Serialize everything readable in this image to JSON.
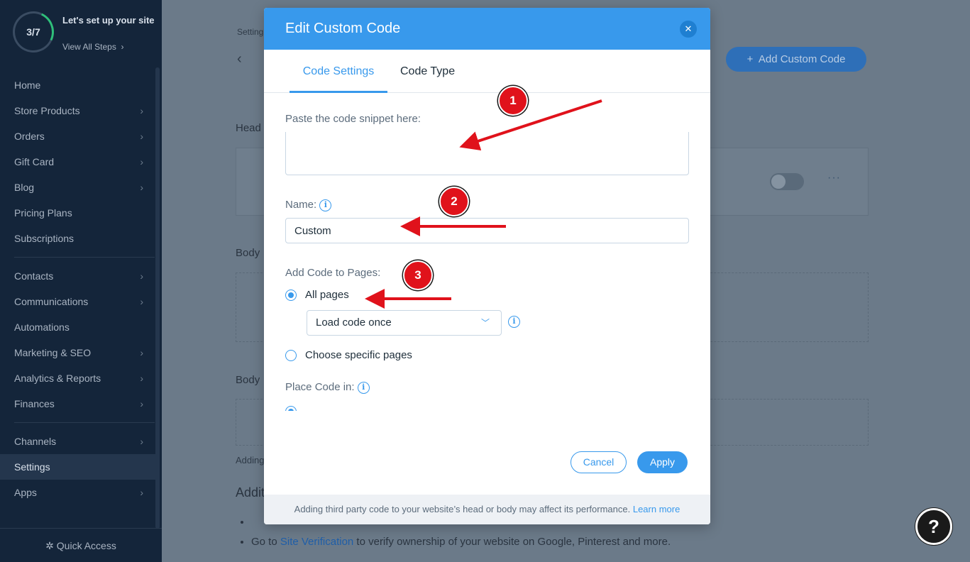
{
  "sidebar": {
    "progress": "3/7",
    "setup_title": "Let's set up your site",
    "setup_link": "View All Steps",
    "items": [
      {
        "label": "Home",
        "chevron": false
      },
      {
        "label": "Store Products",
        "chevron": true
      },
      {
        "label": "Orders",
        "chevron": true
      },
      {
        "label": "Gift Card",
        "chevron": true
      },
      {
        "label": "Blog",
        "chevron": true
      },
      {
        "label": "Pricing Plans",
        "chevron": false
      },
      {
        "label": "Subscriptions",
        "chevron": false
      },
      {
        "label": "Contacts",
        "chevron": true
      },
      {
        "label": "Communications",
        "chevron": true
      },
      {
        "label": "Automations",
        "chevron": false
      },
      {
        "label": "Marketing & SEO",
        "chevron": true
      },
      {
        "label": "Analytics & Reports",
        "chevron": true
      },
      {
        "label": "Finances",
        "chevron": true
      },
      {
        "label": "Channels",
        "chevron": true
      },
      {
        "label": "Settings",
        "chevron": false,
        "active": true
      },
      {
        "label": "Apps",
        "chevron": true
      }
    ],
    "quick_access": "Quick Access"
  },
  "page": {
    "breadcrumb": "Setting",
    "add_button": "Add Custom Code",
    "head_label": "Head",
    "body_label_1": "Body",
    "body_label_2": "Body",
    "adding_note": "Adding",
    "additional_title": "Additi",
    "bullet_2_prefix": "Go to",
    "bullet_2_link": "Site Verification",
    "bullet_2_suffix": "to verify ownership of your website on Google, Pinterest and more."
  },
  "modal": {
    "title": "Edit Custom Code",
    "tabs": [
      "Code Settings",
      "Code Type"
    ],
    "active_tab": "Code Settings",
    "snippet_label": "Paste the code snippet here:",
    "snippet_value": "",
    "name_label": "Name:",
    "name_value": "Custom",
    "pages_label": "Add Code to Pages:",
    "option_all": "All pages",
    "option_all_selected": true,
    "load_select": "Load code once",
    "option_specific": "Choose specific pages",
    "place_label": "Place Code in:",
    "cancel": "Cancel",
    "apply": "Apply",
    "footer_note": "Adding third party code to your website’s head or body may affect its performance.",
    "footer_link": "Learn more"
  },
  "annotations": {
    "badges": [
      "1",
      "2",
      "3"
    ],
    "arrow_color": "#e0121b"
  },
  "help_label": "?",
  "colors": {
    "accent": "#3899ec",
    "sidebar_bg": "#14253a",
    "badge_red": "#e0121b"
  }
}
